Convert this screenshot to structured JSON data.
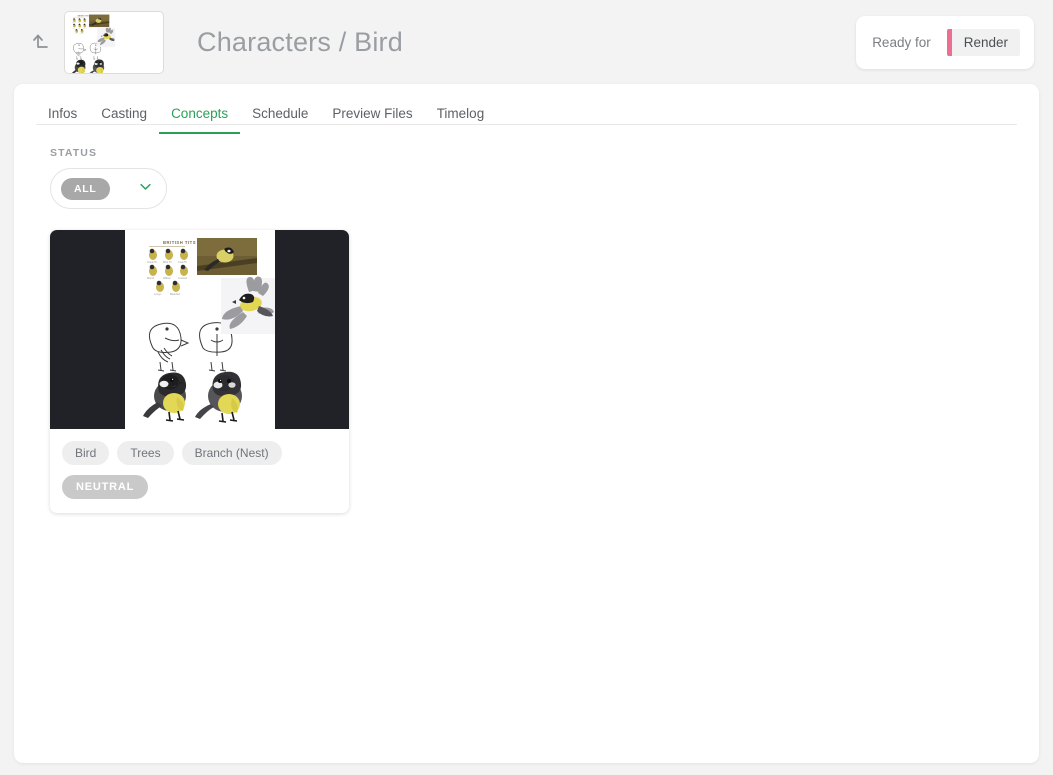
{
  "header": {
    "back_icon": "arrow-up-left-icon",
    "thumbnail_alt": "bird-moodboard-thumbnail",
    "title": "Characters / Bird",
    "status": {
      "label": "Ready for",
      "value": "Render",
      "accent_color": "#ec6f93",
      "chip_bg": "#f1f1f1"
    }
  },
  "tabs": [
    {
      "label": "Infos",
      "active": false
    },
    {
      "label": "Casting",
      "active": false
    },
    {
      "label": "Concepts",
      "active": true
    },
    {
      "label": "Schedule",
      "active": false
    },
    {
      "label": "Preview Files",
      "active": false
    },
    {
      "label": "Timelog",
      "active": false
    }
  ],
  "filter": {
    "label": "STATUS",
    "selected": "ALL",
    "chevron_icon": "chevron-down-icon",
    "accent_color": "#2ca05a"
  },
  "concepts": [
    {
      "media_alt": "great-tit-moodboard",
      "media_bg": "#212227",
      "tags": [
        "Bird",
        "Trees",
        "Branch (Nest)"
      ],
      "state": "NEUTRAL",
      "state_color": "#c9c9c9"
    }
  ],
  "colors": {
    "page_bg": "#f3f3f3",
    "panel_bg": "#ffffff",
    "title": "#9a9ea2",
    "tab_active": "#2ca05a",
    "tag_bg": "#eeeeee"
  }
}
